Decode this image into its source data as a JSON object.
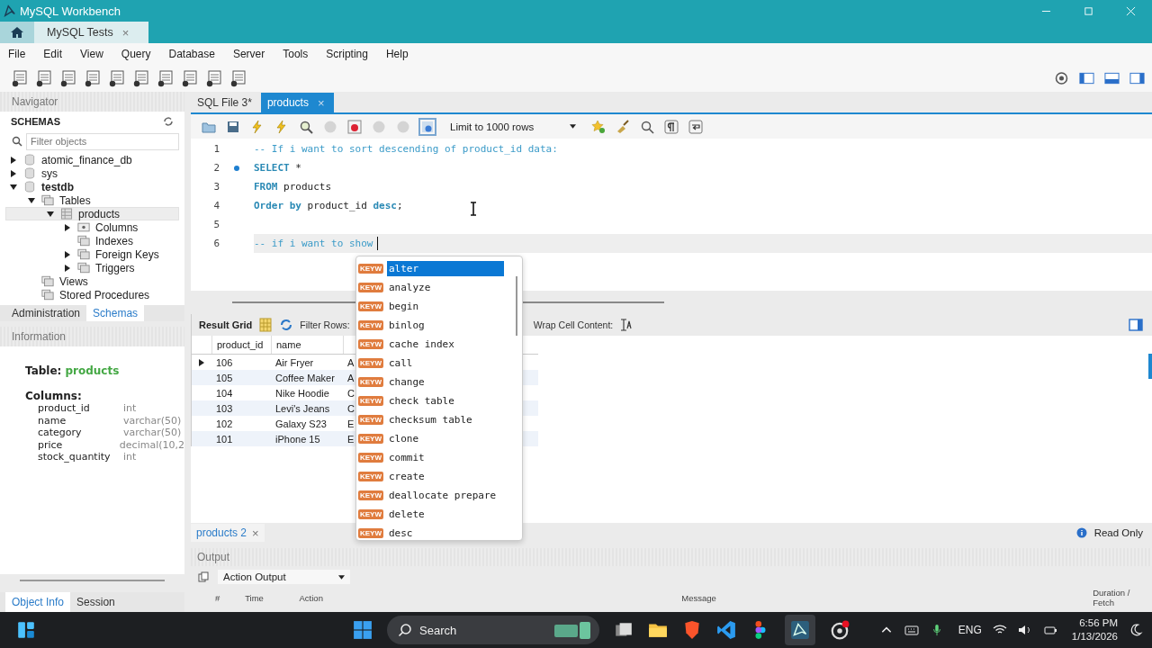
{
  "window": {
    "title": "MySQL Workbench"
  },
  "connection_tabs": [
    {
      "label": "MySQL Tests",
      "close": "×",
      "selected": true
    }
  ],
  "menu": [
    "File",
    "Edit",
    "View",
    "Query",
    "Database",
    "Server",
    "Tools",
    "Scripting",
    "Help"
  ],
  "navigator": {
    "title": "Navigator",
    "schemas_title": "SCHEMAS",
    "filter": {
      "placeholder": "Filter objects"
    },
    "tree": [
      {
        "label": "atomic_finance_db",
        "kind": "schema",
        "active": false,
        "selected": false,
        "expanded": false
      },
      {
        "label": "sys",
        "kind": "schema",
        "active": false,
        "selected": false,
        "expanded": false
      },
      {
        "label": "testdb",
        "kind": "schema",
        "active": true,
        "selected": false,
        "expanded": true,
        "children": [
          {
            "label": "Tables",
            "kind": "folder",
            "selected": false,
            "expanded": true,
            "children": [
              {
                "label": "products",
                "kind": "table",
                "selected": true,
                "expanded": true,
                "children": [
                  {
                    "label": "Columns",
                    "kind": "columns",
                    "selected": false,
                    "expanded": false
                  },
                  {
                    "label": "Indexes",
                    "kind": "folder",
                    "selected": false
                  },
                  {
                    "label": "Foreign Keys",
                    "kind": "folder",
                    "selected": false,
                    "expanded": false
                  },
                  {
                    "label": "Triggers",
                    "kind": "folder",
                    "selected": false,
                    "expanded": false
                  }
                ]
              }
            ]
          },
          {
            "label": "Views",
            "kind": "folder",
            "selected": false
          },
          {
            "label": "Stored Procedures",
            "kind": "folder",
            "selected": false
          }
        ]
      }
    ],
    "tabs": [
      {
        "label": "Administration",
        "selected": false
      },
      {
        "label": "Schemas",
        "selected": true
      }
    ]
  },
  "information": {
    "title": "Information",
    "table_label": "Table:",
    "table_name": "products",
    "columns_label": "Columns:",
    "columns": [
      {
        "name": "product_id",
        "type": "int"
      },
      {
        "name": "name",
        "type": "varchar(50)"
      },
      {
        "name": "category",
        "type": "varchar(50)"
      },
      {
        "name": "price",
        "type": "decimal(10,2"
      },
      {
        "name": "stock_quantity",
        "type": "int"
      }
    ],
    "tabs": [
      {
        "label": "Object Info",
        "selected": true
      },
      {
        "label": "Session",
        "selected": false
      }
    ]
  },
  "sql_tabs": [
    {
      "label": "SQL File 3*",
      "selected": false
    },
    {
      "label": "products",
      "close": "×",
      "selected": true
    }
  ],
  "limit": "Limit to 1000 rows",
  "editor": {
    "lines": [
      {
        "number": "1",
        "marker": false,
        "current": false,
        "tokens": [
          {
            "kind": "comment",
            "text": "-- If i want to sort descending of product_id data:"
          }
        ]
      },
      {
        "number": "2",
        "marker": true,
        "current": false,
        "tokens": [
          {
            "kind": "keyword",
            "text": "SELECT"
          },
          {
            "kind": "plain",
            "text": " *"
          }
        ]
      },
      {
        "number": "3",
        "marker": false,
        "current": false,
        "tokens": [
          {
            "kind": "keyword",
            "text": "FROM"
          },
          {
            "kind": "plain",
            "text": " products"
          }
        ]
      },
      {
        "number": "4",
        "marker": false,
        "current": false,
        "tokens": [
          {
            "kind": "keyword",
            "text": "Order by"
          },
          {
            "kind": "plain",
            "text": " product_id "
          },
          {
            "kind": "keyword",
            "text": "desc"
          },
          {
            "kind": "plain",
            "text": ";"
          }
        ]
      },
      {
        "number": "5",
        "marker": false,
        "current": false
      },
      {
        "number": "6",
        "marker": false,
        "current": true,
        "tokens": [
          {
            "kind": "comment",
            "text": "-- if i want to show"
          }
        ]
      }
    ]
  },
  "autocomplete": {
    "items": [
      {
        "badge": "KEYW",
        "label": "alter",
        "selected": true
      },
      {
        "badge": "KEYW",
        "label": "analyze",
        "selected": false
      },
      {
        "badge": "KEYW",
        "label": "begin",
        "selected": false
      },
      {
        "badge": "KEYW",
        "label": "binlog",
        "selected": false
      },
      {
        "badge": "KEYW",
        "label": "cache index",
        "selected": false
      },
      {
        "badge": "KEYW",
        "label": "call",
        "selected": false
      },
      {
        "badge": "KEYW",
        "label": "change",
        "selected": false
      },
      {
        "badge": "KEYW",
        "label": "check table",
        "selected": false
      },
      {
        "badge": "KEYW",
        "label": "checksum table",
        "selected": false
      },
      {
        "badge": "KEYW",
        "label": "clone",
        "selected": false
      },
      {
        "badge": "KEYW",
        "label": "commit",
        "selected": false
      },
      {
        "badge": "KEYW",
        "label": "create",
        "selected": false
      },
      {
        "badge": "KEYW",
        "label": "deallocate prepare",
        "selected": false
      },
      {
        "badge": "KEYW",
        "label": "delete",
        "selected": false
      },
      {
        "badge": "KEYW",
        "label": "desc",
        "selected": false
      }
    ]
  },
  "result": {
    "grid_label": "Result Grid",
    "filter_label": "Filter Rows:",
    "wrap_label": "Wrap Cell Content:",
    "columns": [
      "product_id",
      "name"
    ],
    "rows": [
      {
        "current": true,
        "cells": [
          "106",
          "Air Fryer",
          "A"
        ]
      },
      {
        "current": false,
        "cells": [
          "105",
          "Coffee Maker",
          "A"
        ]
      },
      {
        "current": false,
        "cells": [
          "104",
          "Nike Hoodie",
          "C"
        ]
      },
      {
        "current": false,
        "cells": [
          "103",
          "Levi's Jeans",
          "C"
        ]
      },
      {
        "current": false,
        "cells": [
          "102",
          "Galaxy S23",
          "E"
        ]
      },
      {
        "current": false,
        "cells": [
          "101",
          "iPhone 15",
          "E"
        ]
      }
    ],
    "tabs": [
      {
        "label": "products 2",
        "close": "×",
        "selected": true
      }
    ],
    "read_only": "Read Only"
  },
  "output": {
    "title": "Output",
    "selector": "Action Output",
    "columns": [
      "#",
      "Time",
      "Action",
      "Message",
      "Duration / Fetch"
    ]
  },
  "taskbar": {
    "search": "Search",
    "language": "ENG",
    "time": "6:56 PM",
    "date": "1/13/2026"
  }
}
